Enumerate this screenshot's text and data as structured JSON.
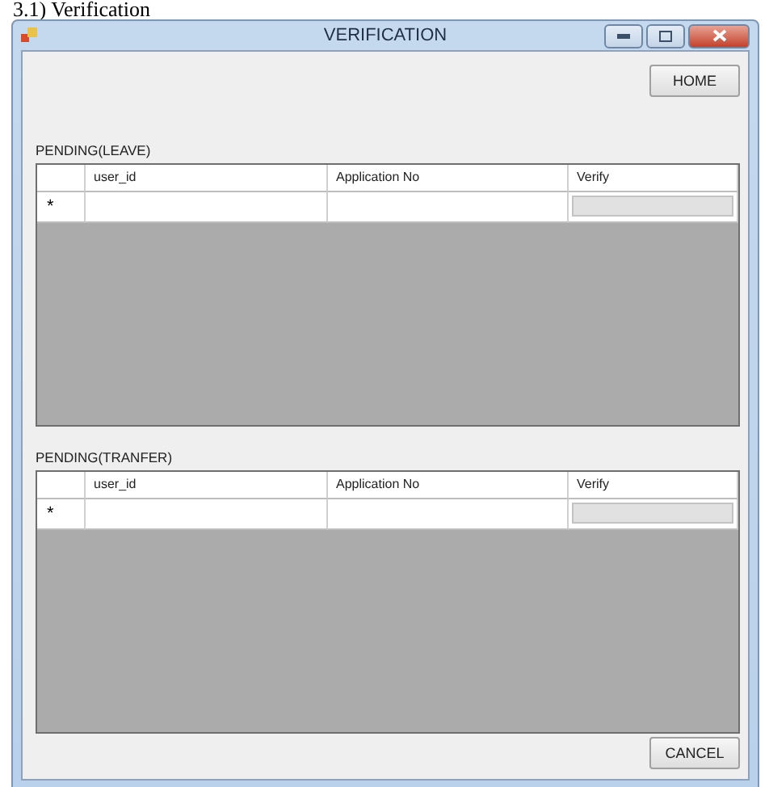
{
  "document_heading": "3.1) Verification",
  "window": {
    "title": "VERIFICATION"
  },
  "home_button": "HOME",
  "grids": [
    {
      "label": "PENDING(LEAVE)",
      "columns": [
        {
          "label": "user_id",
          "kind": "text"
        },
        {
          "label": "Application No",
          "kind": "text"
        },
        {
          "label": "Verify",
          "kind": "button"
        }
      ],
      "new_row_marker": "*"
    },
    {
      "label": "PENDING(TRANFER)",
      "columns": [
        {
          "label": "user_id",
          "kind": "text"
        },
        {
          "label": "Application No",
          "kind": "text"
        },
        {
          "label": "Verify",
          "kind": "button"
        }
      ],
      "new_row_marker": "*"
    }
  ],
  "cancel_button": "CANCEL"
}
